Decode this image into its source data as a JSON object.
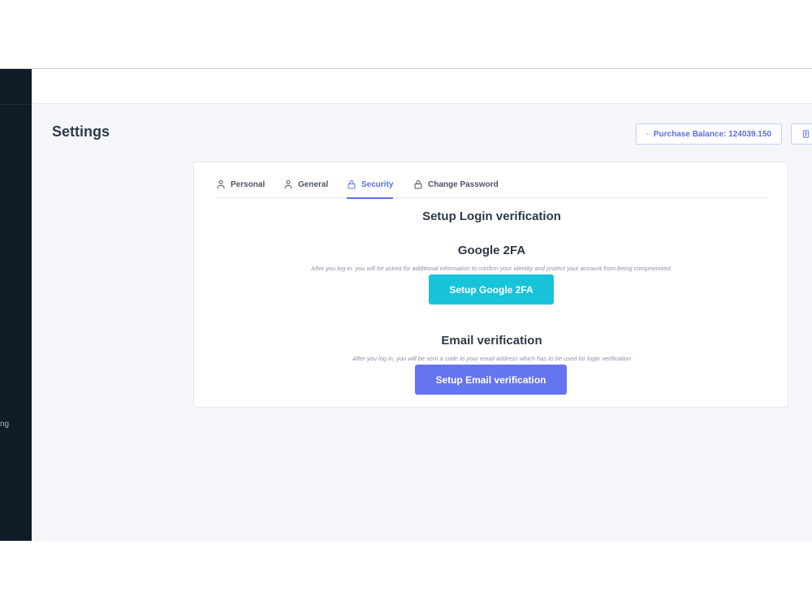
{
  "sidebar": {
    "visible_fragment": "ng"
  },
  "page": {
    "title": "Settings"
  },
  "header_actions": {
    "purchase_balance_label": "Purchase Balance: 124039.150",
    "purchase_icon": "cloud-download-icon",
    "second_icon": "document-icon"
  },
  "tabs": [
    {
      "label": "Personal",
      "icon": "user-icon",
      "active": false
    },
    {
      "label": "General",
      "icon": "user-icon",
      "active": false
    },
    {
      "label": "Security",
      "icon": "lock-icon",
      "active": true
    },
    {
      "label": "Change Password",
      "icon": "lock-icon",
      "active": false
    }
  ],
  "security": {
    "heading": "Setup Login verification",
    "google": {
      "title": "Google 2FA",
      "description": "After you log in, you will be asked for additional information to confirm your identity and protect your account from being compromised.",
      "button_label": "Setup Google 2FA"
    },
    "email": {
      "title": "Email verification",
      "description": "After you log in, you will be sent a code to your email address which has to be used for login verification",
      "button_label": "Setup Email verification"
    }
  },
  "colors": {
    "accent": "#5b6ee8",
    "google_button": "#18c3da",
    "email_button": "#6574f0",
    "sidebar": "#111b27"
  }
}
